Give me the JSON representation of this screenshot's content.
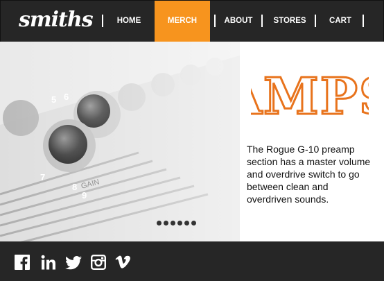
{
  "brand": {
    "logo_text": "smiths"
  },
  "nav": {
    "items": [
      {
        "label": "HOME",
        "active": false
      },
      {
        "label": "MERCH",
        "active": true
      },
      {
        "label": "ABOUT",
        "active": false
      },
      {
        "label": "STORES",
        "active": false
      },
      {
        "label": "CART",
        "active": false
      }
    ]
  },
  "slider": {
    "slide_count": 6
  },
  "feature": {
    "title": "AMPS",
    "description": "The Rogue G-10 preamp section has a master volume and overdrive switch to go between clean and overdriven sounds."
  },
  "social": [
    "facebook-icon",
    "linkedin-icon",
    "twitter-icon",
    "instagram-icon",
    "vimeo-icon"
  ],
  "colors": {
    "accent": "#f7941e",
    "bar": "#262626",
    "title_stroke": "#e8731c"
  }
}
